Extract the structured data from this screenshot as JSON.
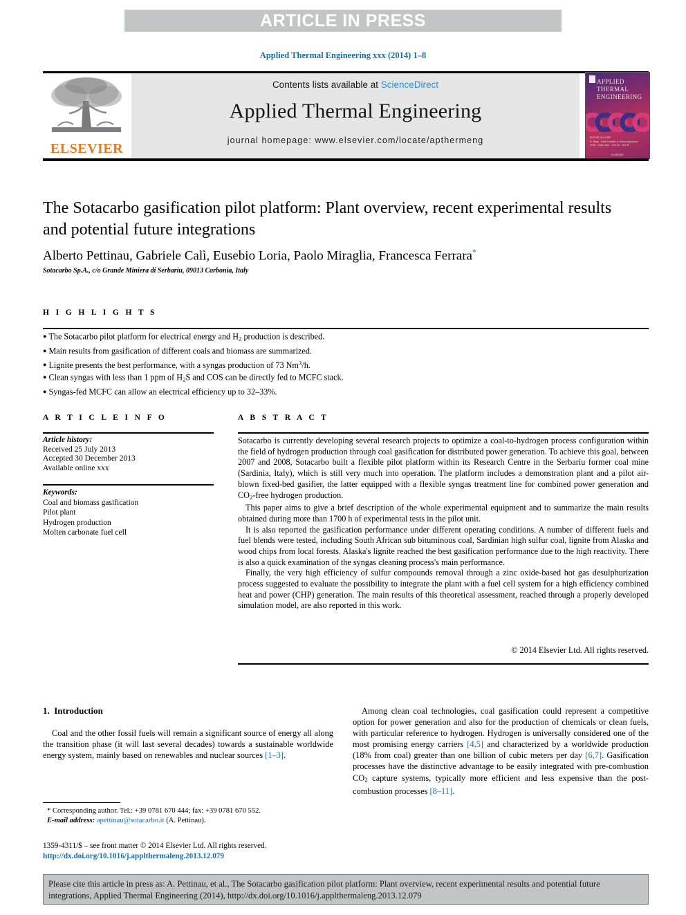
{
  "banner": {
    "text": "ARTICLE IN PRESS"
  },
  "journal_ref": "Applied Thermal Engineering xxx (2014) 1–8",
  "masthead": {
    "publisher": "ELSEVIER",
    "contents_prefix": "Contents lists available at ",
    "sciencedirect": "ScienceDirect",
    "journal_name": "Applied Thermal Engineering",
    "homepage": "journal homepage: www.elsevier.com/locate/apthermeng",
    "cover": {
      "line1": "APPLIED",
      "line2": "THERMAL",
      "line3": "ENGINEERING"
    }
  },
  "article": {
    "title": "The Sotacarbo gasification pilot platform: Plant overview, recent experimental results and potential future integrations",
    "authors": "Alberto Pettinau, Gabriele Calì, Eusebio Loria, Paolo Miraglia, Francesca Ferrara",
    "author_marker": "*",
    "affiliation": "Sotacarbo Sp.A., c/o Grande Miniera di Serbariu, 09013 Carbonia, Italy"
  },
  "highlights": {
    "heading": "H I G H L I G H T S",
    "items": [
      "The Sotacarbo pilot platform for electrical energy and H2 production is described.",
      "Main results from gasification of different coals and biomass are summarized.",
      "Lignite presents the best performance, with a syngas production of 73 Nm3/h.",
      "Clean syngas with less than 1 ppm of H2S and COS can be directly fed to MCFC stack.",
      "Syngas-fed MCFC can allow an electrical efficiency up to 32–33%."
    ]
  },
  "article_info": {
    "heading": "A R T I C L E   I N F O",
    "history_label": "Article history:",
    "history": [
      "Received 25 July 2013",
      "Accepted 30 December 2013",
      "Available online xxx"
    ],
    "keywords_label": "Keywords:",
    "keywords": [
      "Coal and biomass gasification",
      "Pilot plant",
      "Hydrogen production",
      "Molten carbonate fuel cell"
    ]
  },
  "abstract": {
    "heading": "A B S T R A C T",
    "paragraphs": [
      "Sotacarbo is currently developing several research projects to optimize a coal-to-hydrogen process configuration within the field of hydrogen production through coal gasification for distributed power generation. To achieve this goal, between 2007 and 2008, Sotacarbo built a flexible pilot platform within its Research Centre in the Serbariu former coal mine (Sardinia, Italy), which is still very much into operation. The platform includes a demonstration plant and a pilot air-blown fixed-bed gasifier, the latter equipped with a flexible syngas treatment line for combined power generation and CO2-free hydrogen production.",
      "This paper aims to give a brief description of the whole experimental equipment and to summarize the main results obtained during more than 1700 h of experimental tests in the pilot unit.",
      "It is also reported the gasification performance under different operating conditions. A number of different fuels and fuel blends were tested, including South African sub bituminous coal, Sardinian high sulfur coal, lignite from Alaska and wood chips from local forests. Alaska's lignite reached the best gasification performance due to the high reactivity. There is also a quick examination of the syngas cleaning process's main performance.",
      "Finally, the very high efficiency of sulfur compounds removal through a zinc oxide-based hot gas desulphurization process suggested to evaluate the possibility to integrate the plant with a fuel cell system for a high efficiency combined heat and power (CHP) generation. The main results of this theoretical assessment, reached through a properly developed simulation model, are also reported in this work."
    ],
    "copyright": "© 2014 Elsevier Ltd. All rights reserved."
  },
  "body": {
    "section_number": "1.",
    "section_title": "Introduction",
    "left_paragraph": "Coal and the other fossil fuels will remain a significant source of energy all along the transition phase (it will last several decades) towards a sustainable worldwide energy system, mainly based on renewables and nuclear sources ",
    "left_ref": "[1–3]",
    "right_part1": "Among clean coal technologies, coal gasification could represent a competitive option for power generation and also for the production of chemicals or clean fuels, with particular reference to hydrogen. Hydrogen is universally considered one of the most promising energy carriers ",
    "right_ref1": "[4,5]",
    "right_part2": " and characterized by a worldwide production (18% from coal) greater than one billion of cubic meters per day ",
    "right_ref2": "[6,7]",
    "right_part3": ". Gasification processes have the distinctive advantage to be easily integrated with pre-combustion CO2 capture systems, typically more efficient and less expensive than the post-combustion processes ",
    "right_ref3": "[8–11]",
    "right_part4": "."
  },
  "footnote": {
    "corresponding": "* Corresponding author. Tel.: +39 0781 670 444; fax: +39 0781 670 552.",
    "email_label": "E-mail address:",
    "email": "apettinau@sotacarbo.it",
    "email_suffix": "(A. Pettinau).",
    "issn_line": "1359-4311/$ – see front matter © 2014 Elsevier Ltd. All rights reserved.",
    "doi": "http://dx.doi.org/10.1016/j.applthermaleng.2013.12.079"
  },
  "cite_box": {
    "text": "Please cite this article in press as: A. Pettinau, et al., The Sotacarbo gasification pilot platform: Plant overview, recent experimental results and potential future integrations, Applied Thermal Engineering (2014), http://dx.doi.org/10.1016/j.applthermaleng.2013.12.079"
  },
  "colors": {
    "link": "#1a6ba8",
    "banner_bg": "#c3c4c6",
    "masthead_bg": "#e6e6e6",
    "elsevier_orange": "#e87b1e",
    "sciencedirect_blue": "#2e8ccf"
  }
}
